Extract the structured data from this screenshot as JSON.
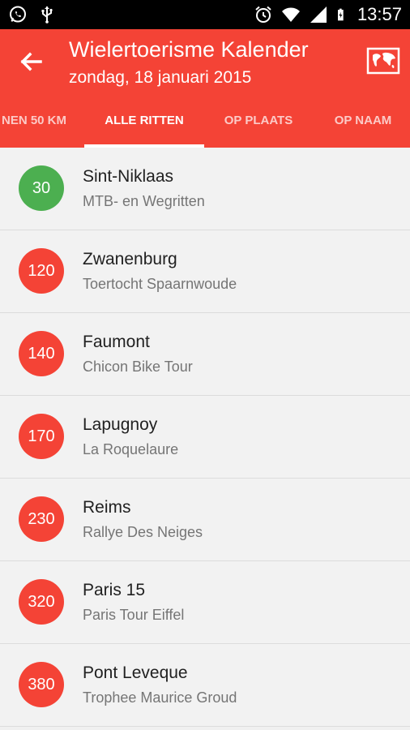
{
  "status_bar": {
    "time": "13:57",
    "left_icons": [
      "whatsapp-icon",
      "usb-icon"
    ],
    "right_icons": [
      "alarm-icon",
      "wifi-icon",
      "signal-icon",
      "battery-icon"
    ]
  },
  "app_bar": {
    "title": "Wielertoerisme Kalender",
    "subtitle": "zondag, 18 januari 2015",
    "back_icon": "arrow-back-icon",
    "map_icon": "world-map-icon",
    "color": "#f44336"
  },
  "tabs": [
    {
      "label": "NEN 50 KM",
      "active": false
    },
    {
      "label": "ALLE RITTEN",
      "active": true
    },
    {
      "label": "OP PLAATS",
      "active": false
    },
    {
      "label": "OP NAAM",
      "active": false
    }
  ],
  "rides": [
    {
      "distance": "30",
      "place": "Sint-Niklaas",
      "event": "MTB- en Wegritten",
      "color": "#4caf50"
    },
    {
      "distance": "120",
      "place": "Zwanenburg",
      "event": "Toertocht Spaarnwoude",
      "color": "#f44336"
    },
    {
      "distance": "140",
      "place": "Faumont",
      "event": "Chicon Bike Tour",
      "color": "#f44336"
    },
    {
      "distance": "170",
      "place": "Lapugnoy",
      "event": "La Roquelaure",
      "color": "#f44336"
    },
    {
      "distance": "230",
      "place": "Reims",
      "event": "Rallye Des Neiges",
      "color": "#f44336"
    },
    {
      "distance": "320",
      "place": "Paris 15",
      "event": "Paris Tour Eiffel",
      "color": "#f44336"
    },
    {
      "distance": "380",
      "place": "Pont Leveque",
      "event": "Trophee Maurice Groud",
      "color": "#f44336"
    }
  ]
}
